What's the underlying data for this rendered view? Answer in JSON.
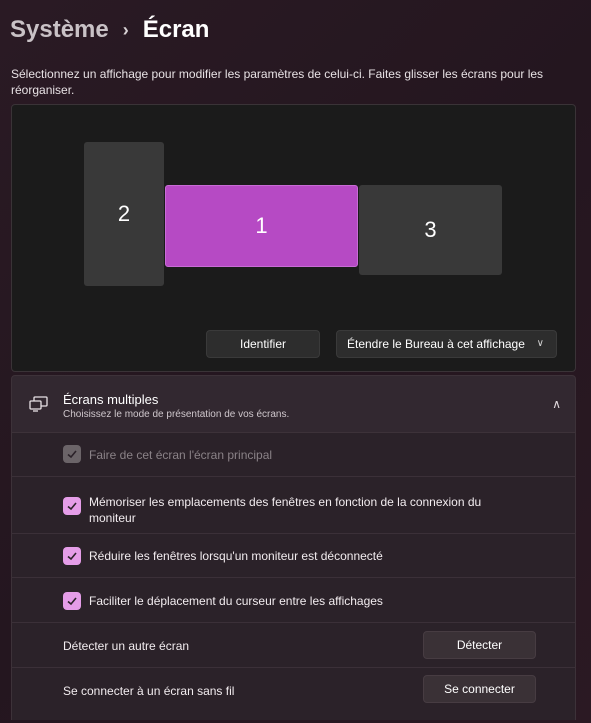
{
  "breadcrumb": {
    "parent": "Système",
    "separator": "›",
    "current": "Écran"
  },
  "intro": "Sélectionnez un affichage pour modifier les paramètres de celui-ci. Faites glisser les écrans pour les réorganiser.",
  "monitors": [
    {
      "label": "2",
      "selected": false
    },
    {
      "label": "1",
      "selected": true
    },
    {
      "label": "3",
      "selected": false
    }
  ],
  "arrange_controls": {
    "identify_label": "Identifier",
    "extend_label": "Étendre le Bureau à cet affichage"
  },
  "multi_display": {
    "title": "Écrans multiples",
    "subtitle": "Choisissez le mode de présentation de vos écrans.",
    "icon": "multi-monitor-icon",
    "expanded": true,
    "options": [
      {
        "label": "Faire de cet écran l'écran principal",
        "checked": true,
        "disabled": true
      },
      {
        "label": "Mémoriser les emplacements des fenêtres en fonction de la connexion du moniteur",
        "checked": true,
        "disabled": false
      },
      {
        "label": "Réduire les fenêtres lorsqu'un moniteur est déconnecté",
        "checked": true,
        "disabled": false
      },
      {
        "label": "Faciliter le déplacement du curseur entre les affichages",
        "checked": true,
        "disabled": false
      }
    ],
    "detect": {
      "label": "Détecter un autre écran",
      "button": "Détecter"
    },
    "wireless": {
      "label": "Se connecter à un écran sans fil",
      "button": "Se connecter"
    }
  },
  "colors": {
    "accent": "#b64ac4",
    "checkbox": "#e59de8",
    "background": "#2a1a24"
  }
}
